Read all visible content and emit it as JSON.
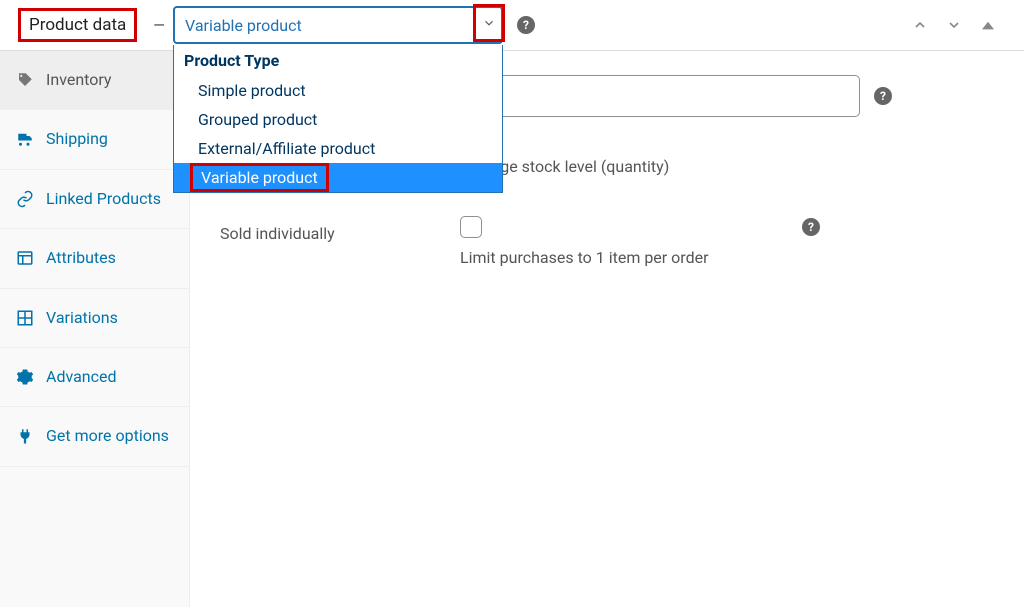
{
  "header": {
    "title": "Product data",
    "selected_product_type": "Variable product",
    "dropdown": {
      "group_label": "Product Type",
      "options": [
        "Simple product",
        "Grouped product",
        "External/Affiliate product",
        "Variable product"
      ]
    }
  },
  "sidebar": {
    "items": [
      {
        "label": "Inventory"
      },
      {
        "label": "Shipping"
      },
      {
        "label": "Linked Products"
      },
      {
        "label": "Attributes"
      },
      {
        "label": "Variations"
      },
      {
        "label": "Advanced"
      },
      {
        "label": "Get more options"
      }
    ]
  },
  "main": {
    "sku": {
      "value": ""
    },
    "manage_stock": {
      "hint": "Manage stock level (quantity)"
    },
    "sold_individually": {
      "label": "Sold individually",
      "hint": "Limit purchases to 1 item per order"
    }
  }
}
